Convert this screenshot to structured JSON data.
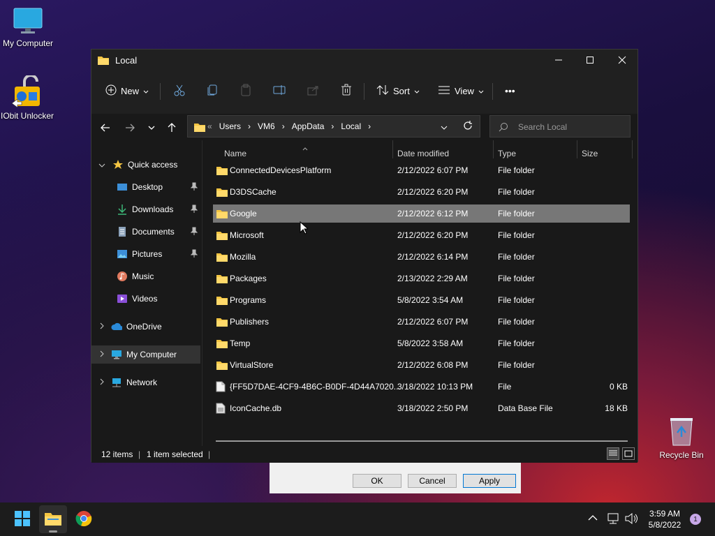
{
  "desktop": {
    "icons": [
      {
        "label": "My Computer"
      },
      {
        "label": "IObit Unlocker"
      },
      {
        "label": "Recycle Bin"
      }
    ]
  },
  "behind_dialog": {
    "ok": "OK",
    "cancel": "Cancel",
    "apply": "Apply"
  },
  "window": {
    "title": "Local",
    "toolbar": {
      "new": "New",
      "sort": "Sort",
      "view": "View",
      "more": "•••"
    },
    "address": {
      "overflow": "«",
      "segments": [
        "Users",
        "VM6",
        "AppData",
        "Local"
      ],
      "search_placeholder": "Search Local"
    },
    "nav": {
      "quick_access": "Quick access",
      "items": [
        {
          "label": "Desktop"
        },
        {
          "label": "Downloads"
        },
        {
          "label": "Documents"
        },
        {
          "label": "Pictures"
        },
        {
          "label": "Music"
        },
        {
          "label": "Videos"
        }
      ],
      "onedrive": "OneDrive",
      "my_computer": "My Computer",
      "network": "Network"
    },
    "columns": {
      "name": "Name",
      "date": "Date modified",
      "type": "Type",
      "size": "Size"
    },
    "files": [
      {
        "name": "ConnectedDevicesPlatform",
        "date": "2/12/2022 6:07 PM",
        "type": "File folder",
        "size": ""
      },
      {
        "name": "D3DSCache",
        "date": "2/12/2022 6:20 PM",
        "type": "File folder",
        "size": ""
      },
      {
        "name": "Google",
        "date": "2/12/2022 6:12 PM",
        "type": "File folder",
        "size": ""
      },
      {
        "name": "Microsoft",
        "date": "2/12/2022 6:20 PM",
        "type": "File folder",
        "size": ""
      },
      {
        "name": "Mozilla",
        "date": "2/12/2022 6:14 PM",
        "type": "File folder",
        "size": ""
      },
      {
        "name": "Packages",
        "date": "2/13/2022 2:29 AM",
        "type": "File folder",
        "size": ""
      },
      {
        "name": "Programs",
        "date": "5/8/2022 3:54 AM",
        "type": "File folder",
        "size": ""
      },
      {
        "name": "Publishers",
        "date": "2/12/2022 6:07 PM",
        "type": "File folder",
        "size": ""
      },
      {
        "name": "Temp",
        "date": "5/8/2022 3:58 AM",
        "type": "File folder",
        "size": ""
      },
      {
        "name": "VirtualStore",
        "date": "2/12/2022 6:08 PM",
        "type": "File folder",
        "size": ""
      },
      {
        "name": "{FF5D7DAE-4CF9-4B6C-B0DF-4D44A7020...",
        "date": "3/18/2022 10:13 PM",
        "type": "File",
        "size": "0 KB"
      },
      {
        "name": "IconCache.db",
        "date": "3/18/2022 2:50 PM",
        "type": "Data Base File",
        "size": "18 KB"
      }
    ],
    "status": {
      "count": "12 items",
      "selected": "1 item selected"
    }
  },
  "taskbar": {
    "time": "3:59 AM",
    "date": "5/8/2022",
    "notifications": "1"
  },
  "colors": {
    "folder": "#f4c542",
    "selection": "#777777",
    "accent": "#0078d4"
  }
}
